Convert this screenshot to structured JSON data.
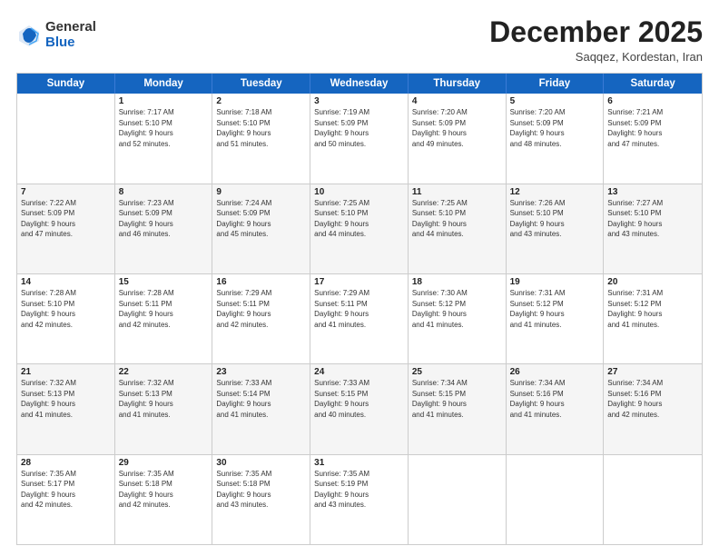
{
  "header": {
    "logo": {
      "general": "General",
      "blue": "Blue"
    },
    "title": "December 2025",
    "subtitle": "Saqqez, Kordestan, Iran"
  },
  "calendar": {
    "days": [
      "Sunday",
      "Monday",
      "Tuesday",
      "Wednesday",
      "Thursday",
      "Friday",
      "Saturday"
    ],
    "rows": [
      [
        {
          "num": "",
          "lines": []
        },
        {
          "num": "1",
          "lines": [
            "Sunrise: 7:17 AM",
            "Sunset: 5:10 PM",
            "Daylight: 9 hours",
            "and 52 minutes."
          ]
        },
        {
          "num": "2",
          "lines": [
            "Sunrise: 7:18 AM",
            "Sunset: 5:10 PM",
            "Daylight: 9 hours",
            "and 51 minutes."
          ]
        },
        {
          "num": "3",
          "lines": [
            "Sunrise: 7:19 AM",
            "Sunset: 5:09 PM",
            "Daylight: 9 hours",
            "and 50 minutes."
          ]
        },
        {
          "num": "4",
          "lines": [
            "Sunrise: 7:20 AM",
            "Sunset: 5:09 PM",
            "Daylight: 9 hours",
            "and 49 minutes."
          ]
        },
        {
          "num": "5",
          "lines": [
            "Sunrise: 7:20 AM",
            "Sunset: 5:09 PM",
            "Daylight: 9 hours",
            "and 48 minutes."
          ]
        },
        {
          "num": "6",
          "lines": [
            "Sunrise: 7:21 AM",
            "Sunset: 5:09 PM",
            "Daylight: 9 hours",
            "and 47 minutes."
          ]
        }
      ],
      [
        {
          "num": "7",
          "lines": [
            "Sunrise: 7:22 AM",
            "Sunset: 5:09 PM",
            "Daylight: 9 hours",
            "and 47 minutes."
          ]
        },
        {
          "num": "8",
          "lines": [
            "Sunrise: 7:23 AM",
            "Sunset: 5:09 PM",
            "Daylight: 9 hours",
            "and 46 minutes."
          ]
        },
        {
          "num": "9",
          "lines": [
            "Sunrise: 7:24 AM",
            "Sunset: 5:09 PM",
            "Daylight: 9 hours",
            "and 45 minutes."
          ]
        },
        {
          "num": "10",
          "lines": [
            "Sunrise: 7:25 AM",
            "Sunset: 5:10 PM",
            "Daylight: 9 hours",
            "and 44 minutes."
          ]
        },
        {
          "num": "11",
          "lines": [
            "Sunrise: 7:25 AM",
            "Sunset: 5:10 PM",
            "Daylight: 9 hours",
            "and 44 minutes."
          ]
        },
        {
          "num": "12",
          "lines": [
            "Sunrise: 7:26 AM",
            "Sunset: 5:10 PM",
            "Daylight: 9 hours",
            "and 43 minutes."
          ]
        },
        {
          "num": "13",
          "lines": [
            "Sunrise: 7:27 AM",
            "Sunset: 5:10 PM",
            "Daylight: 9 hours",
            "and 43 minutes."
          ]
        }
      ],
      [
        {
          "num": "14",
          "lines": [
            "Sunrise: 7:28 AM",
            "Sunset: 5:10 PM",
            "Daylight: 9 hours",
            "and 42 minutes."
          ]
        },
        {
          "num": "15",
          "lines": [
            "Sunrise: 7:28 AM",
            "Sunset: 5:11 PM",
            "Daylight: 9 hours",
            "and 42 minutes."
          ]
        },
        {
          "num": "16",
          "lines": [
            "Sunrise: 7:29 AM",
            "Sunset: 5:11 PM",
            "Daylight: 9 hours",
            "and 42 minutes."
          ]
        },
        {
          "num": "17",
          "lines": [
            "Sunrise: 7:29 AM",
            "Sunset: 5:11 PM",
            "Daylight: 9 hours",
            "and 41 minutes."
          ]
        },
        {
          "num": "18",
          "lines": [
            "Sunrise: 7:30 AM",
            "Sunset: 5:12 PM",
            "Daylight: 9 hours",
            "and 41 minutes."
          ]
        },
        {
          "num": "19",
          "lines": [
            "Sunrise: 7:31 AM",
            "Sunset: 5:12 PM",
            "Daylight: 9 hours",
            "and 41 minutes."
          ]
        },
        {
          "num": "20",
          "lines": [
            "Sunrise: 7:31 AM",
            "Sunset: 5:12 PM",
            "Daylight: 9 hours",
            "and 41 minutes."
          ]
        }
      ],
      [
        {
          "num": "21",
          "lines": [
            "Sunrise: 7:32 AM",
            "Sunset: 5:13 PM",
            "Daylight: 9 hours",
            "and 41 minutes."
          ]
        },
        {
          "num": "22",
          "lines": [
            "Sunrise: 7:32 AM",
            "Sunset: 5:13 PM",
            "Daylight: 9 hours",
            "and 41 minutes."
          ]
        },
        {
          "num": "23",
          "lines": [
            "Sunrise: 7:33 AM",
            "Sunset: 5:14 PM",
            "Daylight: 9 hours",
            "and 41 minutes."
          ]
        },
        {
          "num": "24",
          "lines": [
            "Sunrise: 7:33 AM",
            "Sunset: 5:15 PM",
            "Daylight: 9 hours",
            "and 40 minutes."
          ]
        },
        {
          "num": "25",
          "lines": [
            "Sunrise: 7:34 AM",
            "Sunset: 5:15 PM",
            "Daylight: 9 hours",
            "and 41 minutes."
          ]
        },
        {
          "num": "26",
          "lines": [
            "Sunrise: 7:34 AM",
            "Sunset: 5:16 PM",
            "Daylight: 9 hours",
            "and 41 minutes."
          ]
        },
        {
          "num": "27",
          "lines": [
            "Sunrise: 7:34 AM",
            "Sunset: 5:16 PM",
            "Daylight: 9 hours",
            "and 42 minutes."
          ]
        }
      ],
      [
        {
          "num": "28",
          "lines": [
            "Sunrise: 7:35 AM",
            "Sunset: 5:17 PM",
            "Daylight: 9 hours",
            "and 42 minutes."
          ]
        },
        {
          "num": "29",
          "lines": [
            "Sunrise: 7:35 AM",
            "Sunset: 5:18 PM",
            "Daylight: 9 hours",
            "and 42 minutes."
          ]
        },
        {
          "num": "30",
          "lines": [
            "Sunrise: 7:35 AM",
            "Sunset: 5:18 PM",
            "Daylight: 9 hours",
            "and 43 minutes."
          ]
        },
        {
          "num": "31",
          "lines": [
            "Sunrise: 7:35 AM",
            "Sunset: 5:19 PM",
            "Daylight: 9 hours",
            "and 43 minutes."
          ]
        },
        {
          "num": "",
          "lines": []
        },
        {
          "num": "",
          "lines": []
        },
        {
          "num": "",
          "lines": []
        }
      ]
    ]
  }
}
